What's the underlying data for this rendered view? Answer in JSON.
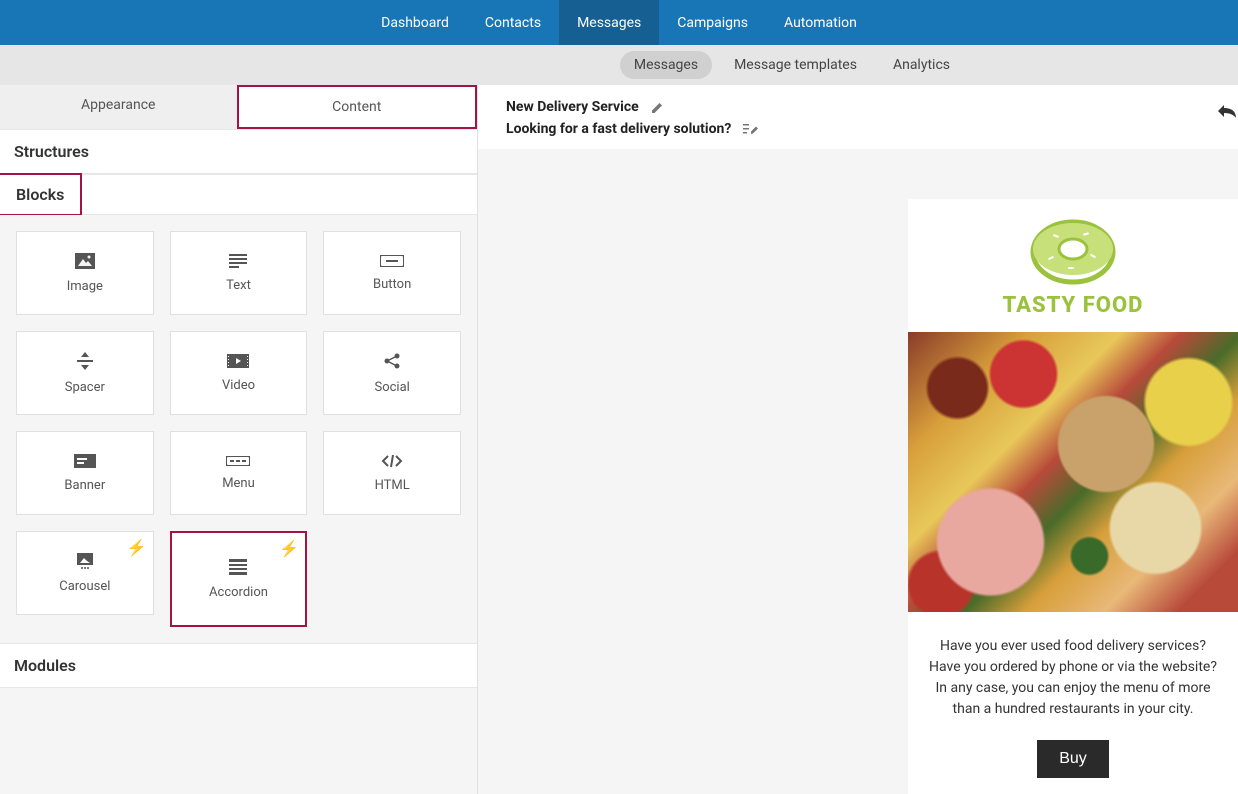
{
  "topnav": {
    "items": [
      "Dashboard",
      "Contacts",
      "Messages",
      "Campaigns",
      "Automation"
    ],
    "active_index": 2
  },
  "subnav": {
    "items": [
      "Messages",
      "Message templates",
      "Analytics"
    ],
    "active_index": 0
  },
  "sidebar": {
    "tabs": [
      "Appearance",
      "Content"
    ],
    "active_tab_index": 1,
    "sections": {
      "structures": "Structures",
      "blocks": "Blocks",
      "modules": "Modules"
    },
    "blocks": [
      {
        "label": "Image",
        "icon": "image"
      },
      {
        "label": "Text",
        "icon": "text"
      },
      {
        "label": "Button",
        "icon": "button"
      },
      {
        "label": "Spacer",
        "icon": "spacer"
      },
      {
        "label": "Video",
        "icon": "video"
      },
      {
        "label": "Social",
        "icon": "social"
      },
      {
        "label": "Banner",
        "icon": "banner"
      },
      {
        "label": "Menu",
        "icon": "menu"
      },
      {
        "label": "HTML",
        "icon": "html"
      },
      {
        "label": "Carousel",
        "icon": "carousel",
        "amp": true
      },
      {
        "label": "Accordion",
        "icon": "accordion",
        "amp": true
      }
    ]
  },
  "message": {
    "title": "New Delivery Service",
    "subject": "Looking for a fast delivery solution?"
  },
  "email_preview": {
    "brand": "TASTY FOOD",
    "body_text": "Have you ever used food delivery services? Have you ordered by phone or via the website? In any case, you can enjoy the menu of more than a hundred restaurants in your city.",
    "cta": "Buy"
  },
  "highlights": {
    "content_tab": true,
    "blocks_header": true,
    "accordion_block": true
  }
}
